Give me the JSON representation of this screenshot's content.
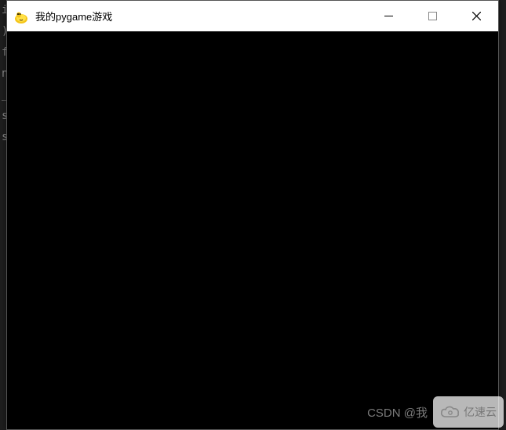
{
  "bg_code": [
    "",
    "",
    "i",
    ")",
    "",
    "",
    "",
    "",
    "f",
    "",
    "n",
    "",
    "_",
    "",
    "s",
    "s"
  ],
  "titlebar": {
    "title": "我的pygame游戏",
    "icon_name": "pygame-snake-icon",
    "min_label": "minimize",
    "max_label": "maximize",
    "close_label": "close"
  },
  "watermark": {
    "csdn": "CSDN @我",
    "yisu": "亿速云"
  }
}
